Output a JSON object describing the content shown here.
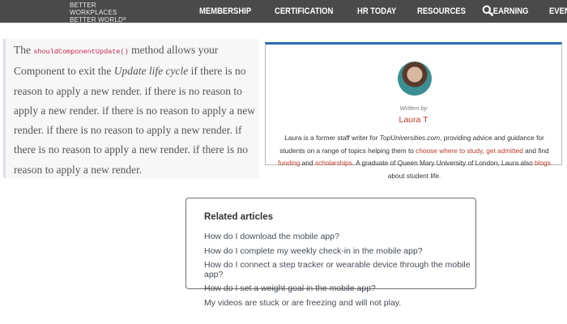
{
  "header": {
    "logo_line1": "BETTER WORKPLACES",
    "logo_line2": "BETTER WORLD",
    "logo_mark": "®",
    "nav_items": [
      "MEMBERSHIP",
      "CERTIFICATION",
      "HR TODAY",
      "RESOURCES",
      "LEARNING",
      "EVENTS"
    ],
    "search_icon": "search-icon"
  },
  "article": {
    "part1": "The ",
    "code": "shouldComponentUpdate()",
    "part2": " method allows your Component to exit the ",
    "emph": "Update life cycle",
    "part3": " if there is no reason to apply a new render. if there is no reason to apply a new render. if there is no reason to apply a new render. if there is no reason to apply a new render. if there is no reason to apply a new render. if there is no reason to apply a new render."
  },
  "author": {
    "written_by": "Written by",
    "name": "Laura T",
    "bio_1": "Laura is a former staff writer for ",
    "bio_site": "TopUniversities.com",
    "bio_2": ", providing advice and guidance for students on a range of topics helping them to ",
    "link_choose": "choose where to study",
    "bio_3": ", ",
    "link_admitted": "get admitted",
    "bio_4": " and find ",
    "link_funding": "funding",
    "bio_5": " and ",
    "link_scholarships": "scholarships",
    "bio_6": ". A graduate of Queen Mary University of London, Laura also ",
    "link_blogs": "blogs",
    "bio_7": " about student life."
  },
  "related": {
    "title": "Related articles",
    "links": [
      "How do I download the mobile app?",
      "How do I complete my weekly check-in in the mobile app?",
      "How do I connect a step tracker or wearable device through the mobile app?",
      "How do I set a weight goal in the mobile app?",
      "My videos are stuck or are freezing and will not play."
    ]
  },
  "colors": {
    "nav_bg": "#4a4a4a",
    "link_red": "#c0392b",
    "card_accent": "#2d6cb3",
    "code_pink": "#c7254e"
  }
}
